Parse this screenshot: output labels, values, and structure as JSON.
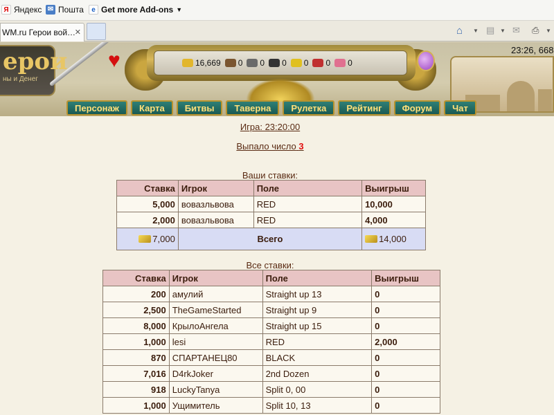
{
  "browser": {
    "bookmarks": [
      {
        "label": "Яндекс",
        "icon": "yandex-icon"
      },
      {
        "label": "Пошта",
        "icon": "mail-icon"
      },
      {
        "label": "Get more Add-ons",
        "icon": "ie-icon"
      }
    ],
    "tab_title": "WM.ru Герои вой…"
  },
  "header": {
    "logo_text": "ерои",
    "logo_sub": "ны и Денег",
    "clock": "23:26, 668",
    "resources": [
      {
        "icon": "gold-icon",
        "value": "16,669",
        "color": "#e2b62c"
      },
      {
        "icon": "wood-icon",
        "value": "0",
        "color": "#7a5530"
      },
      {
        "icon": "ore-icon",
        "value": "0",
        "color": "#6a6a6a"
      },
      {
        "icon": "mercury-icon",
        "value": "0",
        "color": "#333333"
      },
      {
        "icon": "sulfur-icon",
        "value": "0",
        "color": "#e0c020"
      },
      {
        "icon": "crystal-icon",
        "value": "0",
        "color": "#c03030"
      },
      {
        "icon": "gems-icon",
        "value": "0",
        "color": "#e07090"
      }
    ]
  },
  "nav": {
    "items": [
      "Персонаж",
      "Карта",
      "Битвы",
      "Таверна",
      "Рулетка",
      "Рейтинг",
      "Форум",
      "Чат"
    ]
  },
  "game": {
    "link": "Игра: 23:20:00",
    "result_label": "Выпало число",
    "result_number": "3"
  },
  "your_bets": {
    "caption": "Ваши ставки:",
    "headers": [
      "Ставка",
      "Игрок",
      "Поле",
      "Выигрыш"
    ],
    "rows": [
      [
        "5,000",
        "вовазльвова",
        "RED",
        "10,000"
      ],
      [
        "2,000",
        "вовазльвова",
        "RED",
        "4,000"
      ]
    ],
    "total_label": "Всего",
    "total_bet": "7,000",
    "total_win": "14,000"
  },
  "all_bets": {
    "caption": "Все ставки:",
    "headers": [
      "Ставка",
      "Игрок",
      "Поле",
      "Выигрыш"
    ],
    "rows": [
      [
        "200",
        "амулий",
        "Straight up 13",
        "0"
      ],
      [
        "2,500",
        "TheGameStarted",
        "Straight up 9",
        "0"
      ],
      [
        "8,000",
        "КрылоАнгела",
        "Straight up 15",
        "0"
      ],
      [
        "1,000",
        "lesi",
        "RED",
        "2,000"
      ],
      [
        "870",
        "СПАРТАНЕЦ80",
        "BLACK",
        "0"
      ],
      [
        "7,016",
        "D4rkJoker",
        "2nd Dozen",
        "0"
      ],
      [
        "918",
        "LuckyTanya",
        "Split 0, 00",
        "0"
      ],
      [
        "1,000",
        "Ущимитель",
        "Split 10, 13",
        "0"
      ]
    ]
  }
}
